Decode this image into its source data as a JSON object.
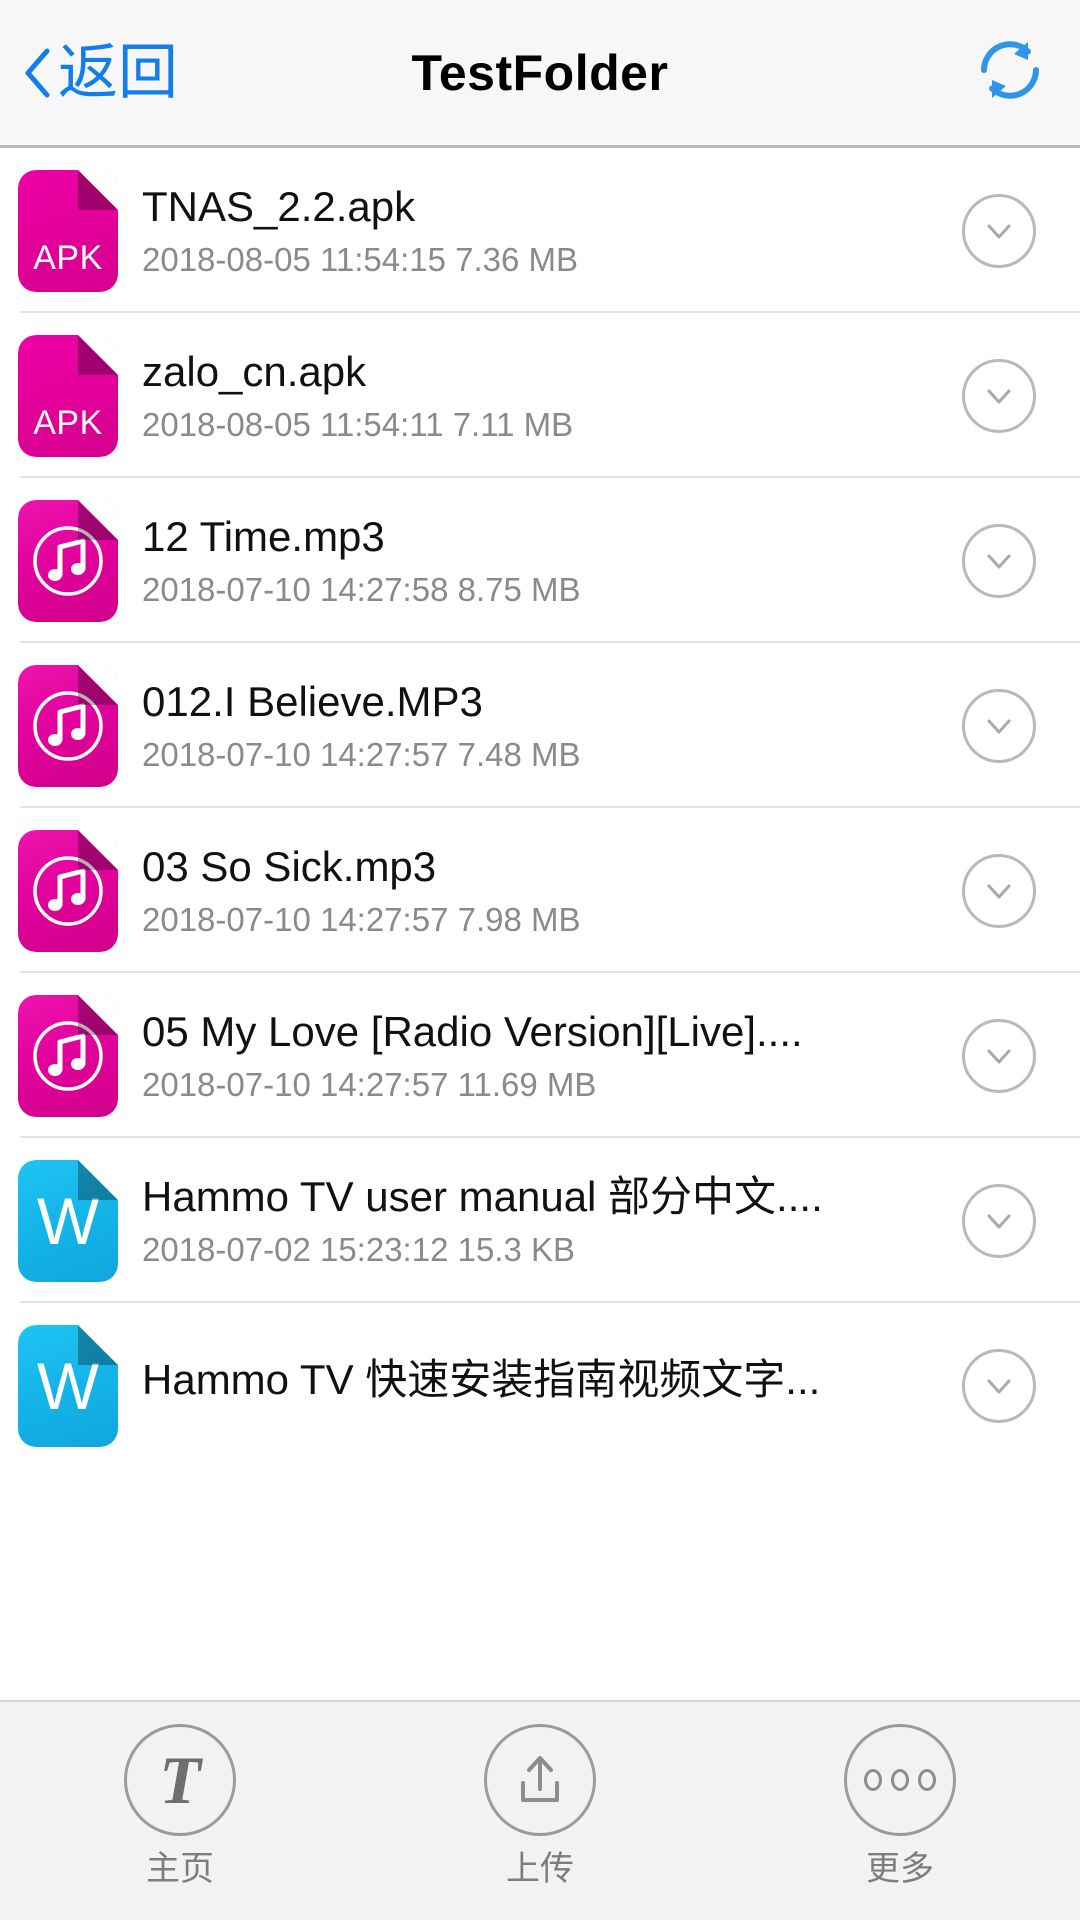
{
  "header": {
    "back_label": "返回",
    "back_icon": "chevron-left-icon",
    "title": "TestFolder",
    "refresh_icon": "refresh-icon",
    "accent_color": "#147ee8",
    "title_color": "#000000",
    "background": "#f7f7f7"
  },
  "colors": {
    "apk_icon": "#E4009B",
    "mp3_icon": "#E2029C",
    "doc_icon": "#14B4E8",
    "filename": "#111111",
    "meta": "#8a8a8a",
    "divider": "#e2e2e2",
    "bottom_bar": "#f2f2f2",
    "bottom_icon": "#9b9b9b"
  },
  "files": [
    {
      "name": "TNAS_2.2.apk",
      "meta": "2018-08-05 11:54:15 7.36 MB",
      "date": "2018-08-05 11:54:15",
      "size": "7.36 MB",
      "type": "apk",
      "icon_label": "APK",
      "expand_icon": "chevron-down-icon"
    },
    {
      "name": "zalo_cn.apk",
      "meta": "2018-08-05 11:54:11 7.11 MB",
      "date": "2018-08-05 11:54:11",
      "size": "7.11 MB",
      "type": "apk",
      "icon_label": "APK",
      "expand_icon": "chevron-down-icon"
    },
    {
      "name": "12 Time.mp3",
      "meta": "2018-07-10 14:27:58 8.75 MB",
      "date": "2018-07-10 14:27:58",
      "size": "8.75 MB",
      "type": "mp3",
      "icon_label": "music-note-icon",
      "expand_icon": "chevron-down-icon"
    },
    {
      "name": "012.I Believe.MP3",
      "meta": "2018-07-10 14:27:57 7.48 MB",
      "date": "2018-07-10 14:27:57",
      "size": "7.48 MB",
      "type": "mp3",
      "icon_label": "music-note-icon",
      "expand_icon": "chevron-down-icon"
    },
    {
      "name": "03 So Sick.mp3",
      "meta": "2018-07-10 14:27:57 7.98 MB",
      "date": "2018-07-10 14:27:57",
      "size": "7.98 MB",
      "type": "mp3",
      "icon_label": "music-note-icon",
      "expand_icon": "chevron-down-icon"
    },
    {
      "name": "05 My Love [Radio Version][Live]....",
      "meta": "2018-07-10 14:27:57 11.69 MB",
      "date": "2018-07-10 14:27:57",
      "size": "11.69 MB",
      "type": "mp3",
      "icon_label": "music-note-icon",
      "expand_icon": "chevron-down-icon"
    },
    {
      "name": "Hammo TV user manual 部分中文....",
      "meta": "2018-07-02 15:23:12 15.3 KB",
      "date": "2018-07-02 15:23:12",
      "size": "15.3 KB",
      "type": "doc",
      "icon_label": "W",
      "expand_icon": "chevron-down-icon"
    },
    {
      "name": "Hammo TV 快速安装指南视频文字...",
      "meta": "",
      "date": "",
      "size": "",
      "type": "doc",
      "icon_label": "W",
      "expand_icon": "chevron-down-icon"
    }
  ],
  "bottom_bar": {
    "items": [
      {
        "label": "主页",
        "icon": "text-t-icon"
      },
      {
        "label": "上传",
        "icon": "upload-icon"
      },
      {
        "label": "更多",
        "icon": "more-dots-icon"
      }
    ]
  }
}
